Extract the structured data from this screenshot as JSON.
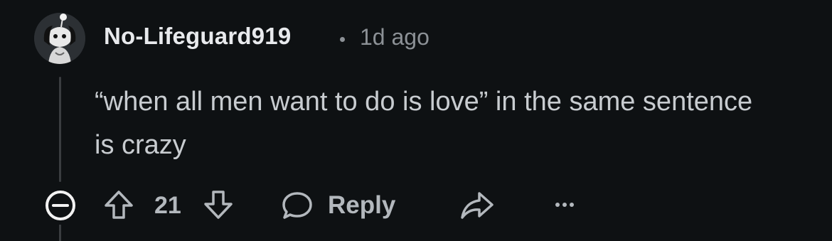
{
  "comment": {
    "author": "No-Lifeguard919",
    "separator": "•",
    "time": "1d ago",
    "body": "“when all men want to do is love” in the same sentence is crazy",
    "score": "21"
  },
  "actions": {
    "reply_label": "Reply"
  },
  "icons": {
    "collapse": "minus-circle-icon",
    "upvote": "arrow-up-icon",
    "downvote": "arrow-down-icon",
    "reply": "speech-bubble-icon",
    "share": "share-arrow-icon",
    "more": "ellipsis-icon"
  },
  "colors": {
    "background": "#0e1113",
    "author": "#e8eaed",
    "muted": "#8c9196",
    "body": "#c8ccd0",
    "icon": "#b3b8bd"
  }
}
